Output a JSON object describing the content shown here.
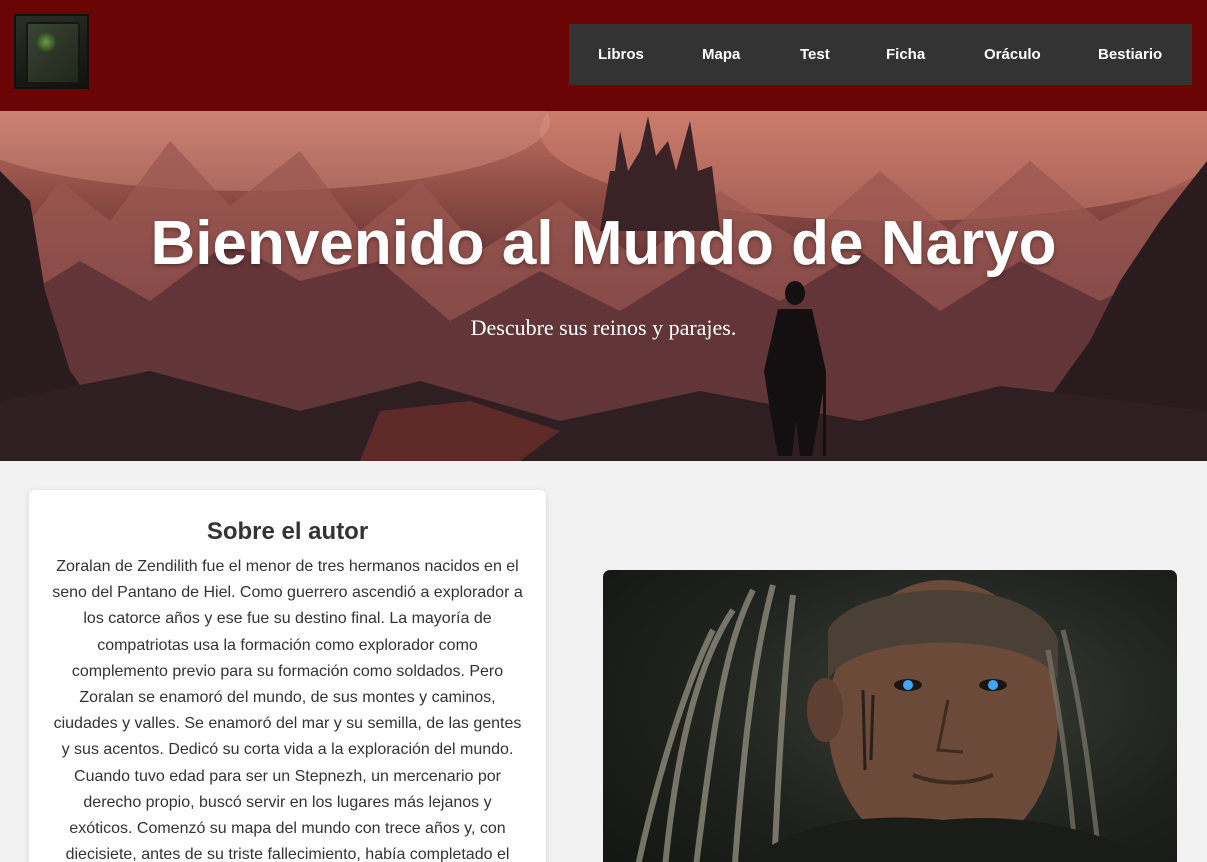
{
  "header": {
    "logo_icon": "book-logo-icon",
    "colors": {
      "bar": "#6b0404",
      "nav": "#333333"
    },
    "nav": [
      {
        "label": "Libros"
      },
      {
        "label": "Mapa"
      },
      {
        "label": "Test"
      },
      {
        "label": "Ficha"
      },
      {
        "label": "Oráculo"
      },
      {
        "label": "Bestiario"
      }
    ]
  },
  "hero": {
    "title": "Bienvenido al Mundo de Naryo",
    "subtitle": "Descubre sus reinos y parajes."
  },
  "about": {
    "heading": "Sobre el autor",
    "text": "Zoralan de Zendilith fue el menor de tres hermanos nacidos en el seno del Pantano de Hiel. Como guerrero ascendió a explorador a los catorce años y ese fue su destino final. La mayoría de compatriotas usa la formación como explorador como complemento previo para su formación como soldados. Pero Zoralan se enamoró del mundo, de sus montes y caminos, ciudades y valles. Se enamoró del mar y su semilla, de las gentes y sus acentos. Dedicó su corta vida a la exploración del mundo. Cuando tuvo edad para ser un Stepnezh, un mercenario por derecho propio, buscó servir en los lugares más lejanos y exóticos. Comenzó su mapa del mundo con trece años y, con diecisiete, antes de su triste fallecimiento, había completado el"
  }
}
